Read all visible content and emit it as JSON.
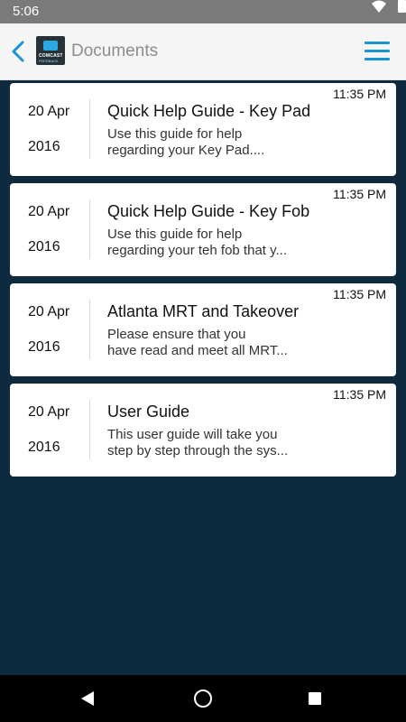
{
  "status": {
    "time": "5:06"
  },
  "appbar": {
    "title": "Documents",
    "logo_text_1": "COMCAST",
    "logo_text_2": "FEEDBACK"
  },
  "documents": [
    {
      "time": "11:35 PM",
      "day": "20 Apr",
      "year": "2016",
      "title": "Quick Help Guide - Key Pad",
      "desc_line1": "Use this guide for help",
      "desc_line2": "regarding your Key Pad...."
    },
    {
      "time": "11:35 PM",
      "day": "20 Apr",
      "year": "2016",
      "title": "Quick Help Guide - Key Fob",
      "desc_line1": "Use this guide for help",
      "desc_line2": "regarding your teh fob that y..."
    },
    {
      "time": "11:35 PM",
      "day": "20 Apr",
      "year": "2016",
      "title": "Atlanta MRT and Takeover",
      "desc_line1": "Please ensure that you",
      "desc_line2": "have read and meet all MRT..."
    },
    {
      "time": "11:35 PM",
      "day": "20 Apr",
      "year": "2016",
      "title": "User Guide",
      "desc_line1": "This user guide will take you",
      "desc_line2": "step by step through the sys..."
    }
  ],
  "colors": {
    "accent": "#1a93d2",
    "background": "#0e2a3f",
    "statusbar": "#7a7a7a"
  }
}
